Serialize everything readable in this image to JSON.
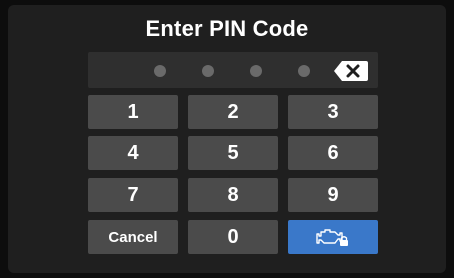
{
  "title": "Enter PIN Code",
  "pin": {
    "digits_entered": 0,
    "max_digits": 4
  },
  "keys": {
    "k1": "1",
    "k2": "2",
    "k3": "3",
    "k4": "4",
    "k5": "5",
    "k6": "6",
    "k7": "7",
    "k8": "8",
    "k9": "9",
    "cancel": "Cancel",
    "k0": "0"
  },
  "icons": {
    "backspace": "backspace-icon",
    "engine_lock": "engine-lock-icon"
  },
  "colors": {
    "background": "#1f1f1f",
    "key": "#4b4b4b",
    "accent": "#3a78c9",
    "dot": "#6a6a6a"
  }
}
